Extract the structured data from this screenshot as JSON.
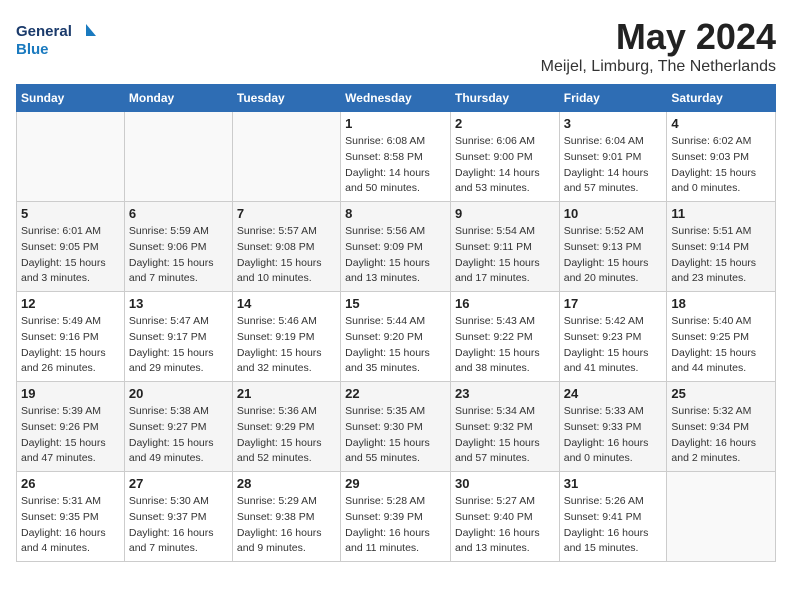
{
  "header": {
    "logo_line1": "General",
    "logo_line2": "Blue",
    "month": "May 2024",
    "location": "Meijel, Limburg, The Netherlands"
  },
  "days_of_week": [
    "Sunday",
    "Monday",
    "Tuesday",
    "Wednesday",
    "Thursday",
    "Friday",
    "Saturday"
  ],
  "weeks": [
    [
      {
        "num": "",
        "info": ""
      },
      {
        "num": "",
        "info": ""
      },
      {
        "num": "",
        "info": ""
      },
      {
        "num": "1",
        "info": "Sunrise: 6:08 AM\nSunset: 8:58 PM\nDaylight: 14 hours\nand 50 minutes."
      },
      {
        "num": "2",
        "info": "Sunrise: 6:06 AM\nSunset: 9:00 PM\nDaylight: 14 hours\nand 53 minutes."
      },
      {
        "num": "3",
        "info": "Sunrise: 6:04 AM\nSunset: 9:01 PM\nDaylight: 14 hours\nand 57 minutes."
      },
      {
        "num": "4",
        "info": "Sunrise: 6:02 AM\nSunset: 9:03 PM\nDaylight: 15 hours\nand 0 minutes."
      }
    ],
    [
      {
        "num": "5",
        "info": "Sunrise: 6:01 AM\nSunset: 9:05 PM\nDaylight: 15 hours\nand 3 minutes."
      },
      {
        "num": "6",
        "info": "Sunrise: 5:59 AM\nSunset: 9:06 PM\nDaylight: 15 hours\nand 7 minutes."
      },
      {
        "num": "7",
        "info": "Sunrise: 5:57 AM\nSunset: 9:08 PM\nDaylight: 15 hours\nand 10 minutes."
      },
      {
        "num": "8",
        "info": "Sunrise: 5:56 AM\nSunset: 9:09 PM\nDaylight: 15 hours\nand 13 minutes."
      },
      {
        "num": "9",
        "info": "Sunrise: 5:54 AM\nSunset: 9:11 PM\nDaylight: 15 hours\nand 17 minutes."
      },
      {
        "num": "10",
        "info": "Sunrise: 5:52 AM\nSunset: 9:13 PM\nDaylight: 15 hours\nand 20 minutes."
      },
      {
        "num": "11",
        "info": "Sunrise: 5:51 AM\nSunset: 9:14 PM\nDaylight: 15 hours\nand 23 minutes."
      }
    ],
    [
      {
        "num": "12",
        "info": "Sunrise: 5:49 AM\nSunset: 9:16 PM\nDaylight: 15 hours\nand 26 minutes."
      },
      {
        "num": "13",
        "info": "Sunrise: 5:47 AM\nSunset: 9:17 PM\nDaylight: 15 hours\nand 29 minutes."
      },
      {
        "num": "14",
        "info": "Sunrise: 5:46 AM\nSunset: 9:19 PM\nDaylight: 15 hours\nand 32 minutes."
      },
      {
        "num": "15",
        "info": "Sunrise: 5:44 AM\nSunset: 9:20 PM\nDaylight: 15 hours\nand 35 minutes."
      },
      {
        "num": "16",
        "info": "Sunrise: 5:43 AM\nSunset: 9:22 PM\nDaylight: 15 hours\nand 38 minutes."
      },
      {
        "num": "17",
        "info": "Sunrise: 5:42 AM\nSunset: 9:23 PM\nDaylight: 15 hours\nand 41 minutes."
      },
      {
        "num": "18",
        "info": "Sunrise: 5:40 AM\nSunset: 9:25 PM\nDaylight: 15 hours\nand 44 minutes."
      }
    ],
    [
      {
        "num": "19",
        "info": "Sunrise: 5:39 AM\nSunset: 9:26 PM\nDaylight: 15 hours\nand 47 minutes."
      },
      {
        "num": "20",
        "info": "Sunrise: 5:38 AM\nSunset: 9:27 PM\nDaylight: 15 hours\nand 49 minutes."
      },
      {
        "num": "21",
        "info": "Sunrise: 5:36 AM\nSunset: 9:29 PM\nDaylight: 15 hours\nand 52 minutes."
      },
      {
        "num": "22",
        "info": "Sunrise: 5:35 AM\nSunset: 9:30 PM\nDaylight: 15 hours\nand 55 minutes."
      },
      {
        "num": "23",
        "info": "Sunrise: 5:34 AM\nSunset: 9:32 PM\nDaylight: 15 hours\nand 57 minutes."
      },
      {
        "num": "24",
        "info": "Sunrise: 5:33 AM\nSunset: 9:33 PM\nDaylight: 16 hours\nand 0 minutes."
      },
      {
        "num": "25",
        "info": "Sunrise: 5:32 AM\nSunset: 9:34 PM\nDaylight: 16 hours\nand 2 minutes."
      }
    ],
    [
      {
        "num": "26",
        "info": "Sunrise: 5:31 AM\nSunset: 9:35 PM\nDaylight: 16 hours\nand 4 minutes."
      },
      {
        "num": "27",
        "info": "Sunrise: 5:30 AM\nSunset: 9:37 PM\nDaylight: 16 hours\nand 7 minutes."
      },
      {
        "num": "28",
        "info": "Sunrise: 5:29 AM\nSunset: 9:38 PM\nDaylight: 16 hours\nand 9 minutes."
      },
      {
        "num": "29",
        "info": "Sunrise: 5:28 AM\nSunset: 9:39 PM\nDaylight: 16 hours\nand 11 minutes."
      },
      {
        "num": "30",
        "info": "Sunrise: 5:27 AM\nSunset: 9:40 PM\nDaylight: 16 hours\nand 13 minutes."
      },
      {
        "num": "31",
        "info": "Sunrise: 5:26 AM\nSunset: 9:41 PM\nDaylight: 16 hours\nand 15 minutes."
      },
      {
        "num": "",
        "info": ""
      }
    ]
  ]
}
